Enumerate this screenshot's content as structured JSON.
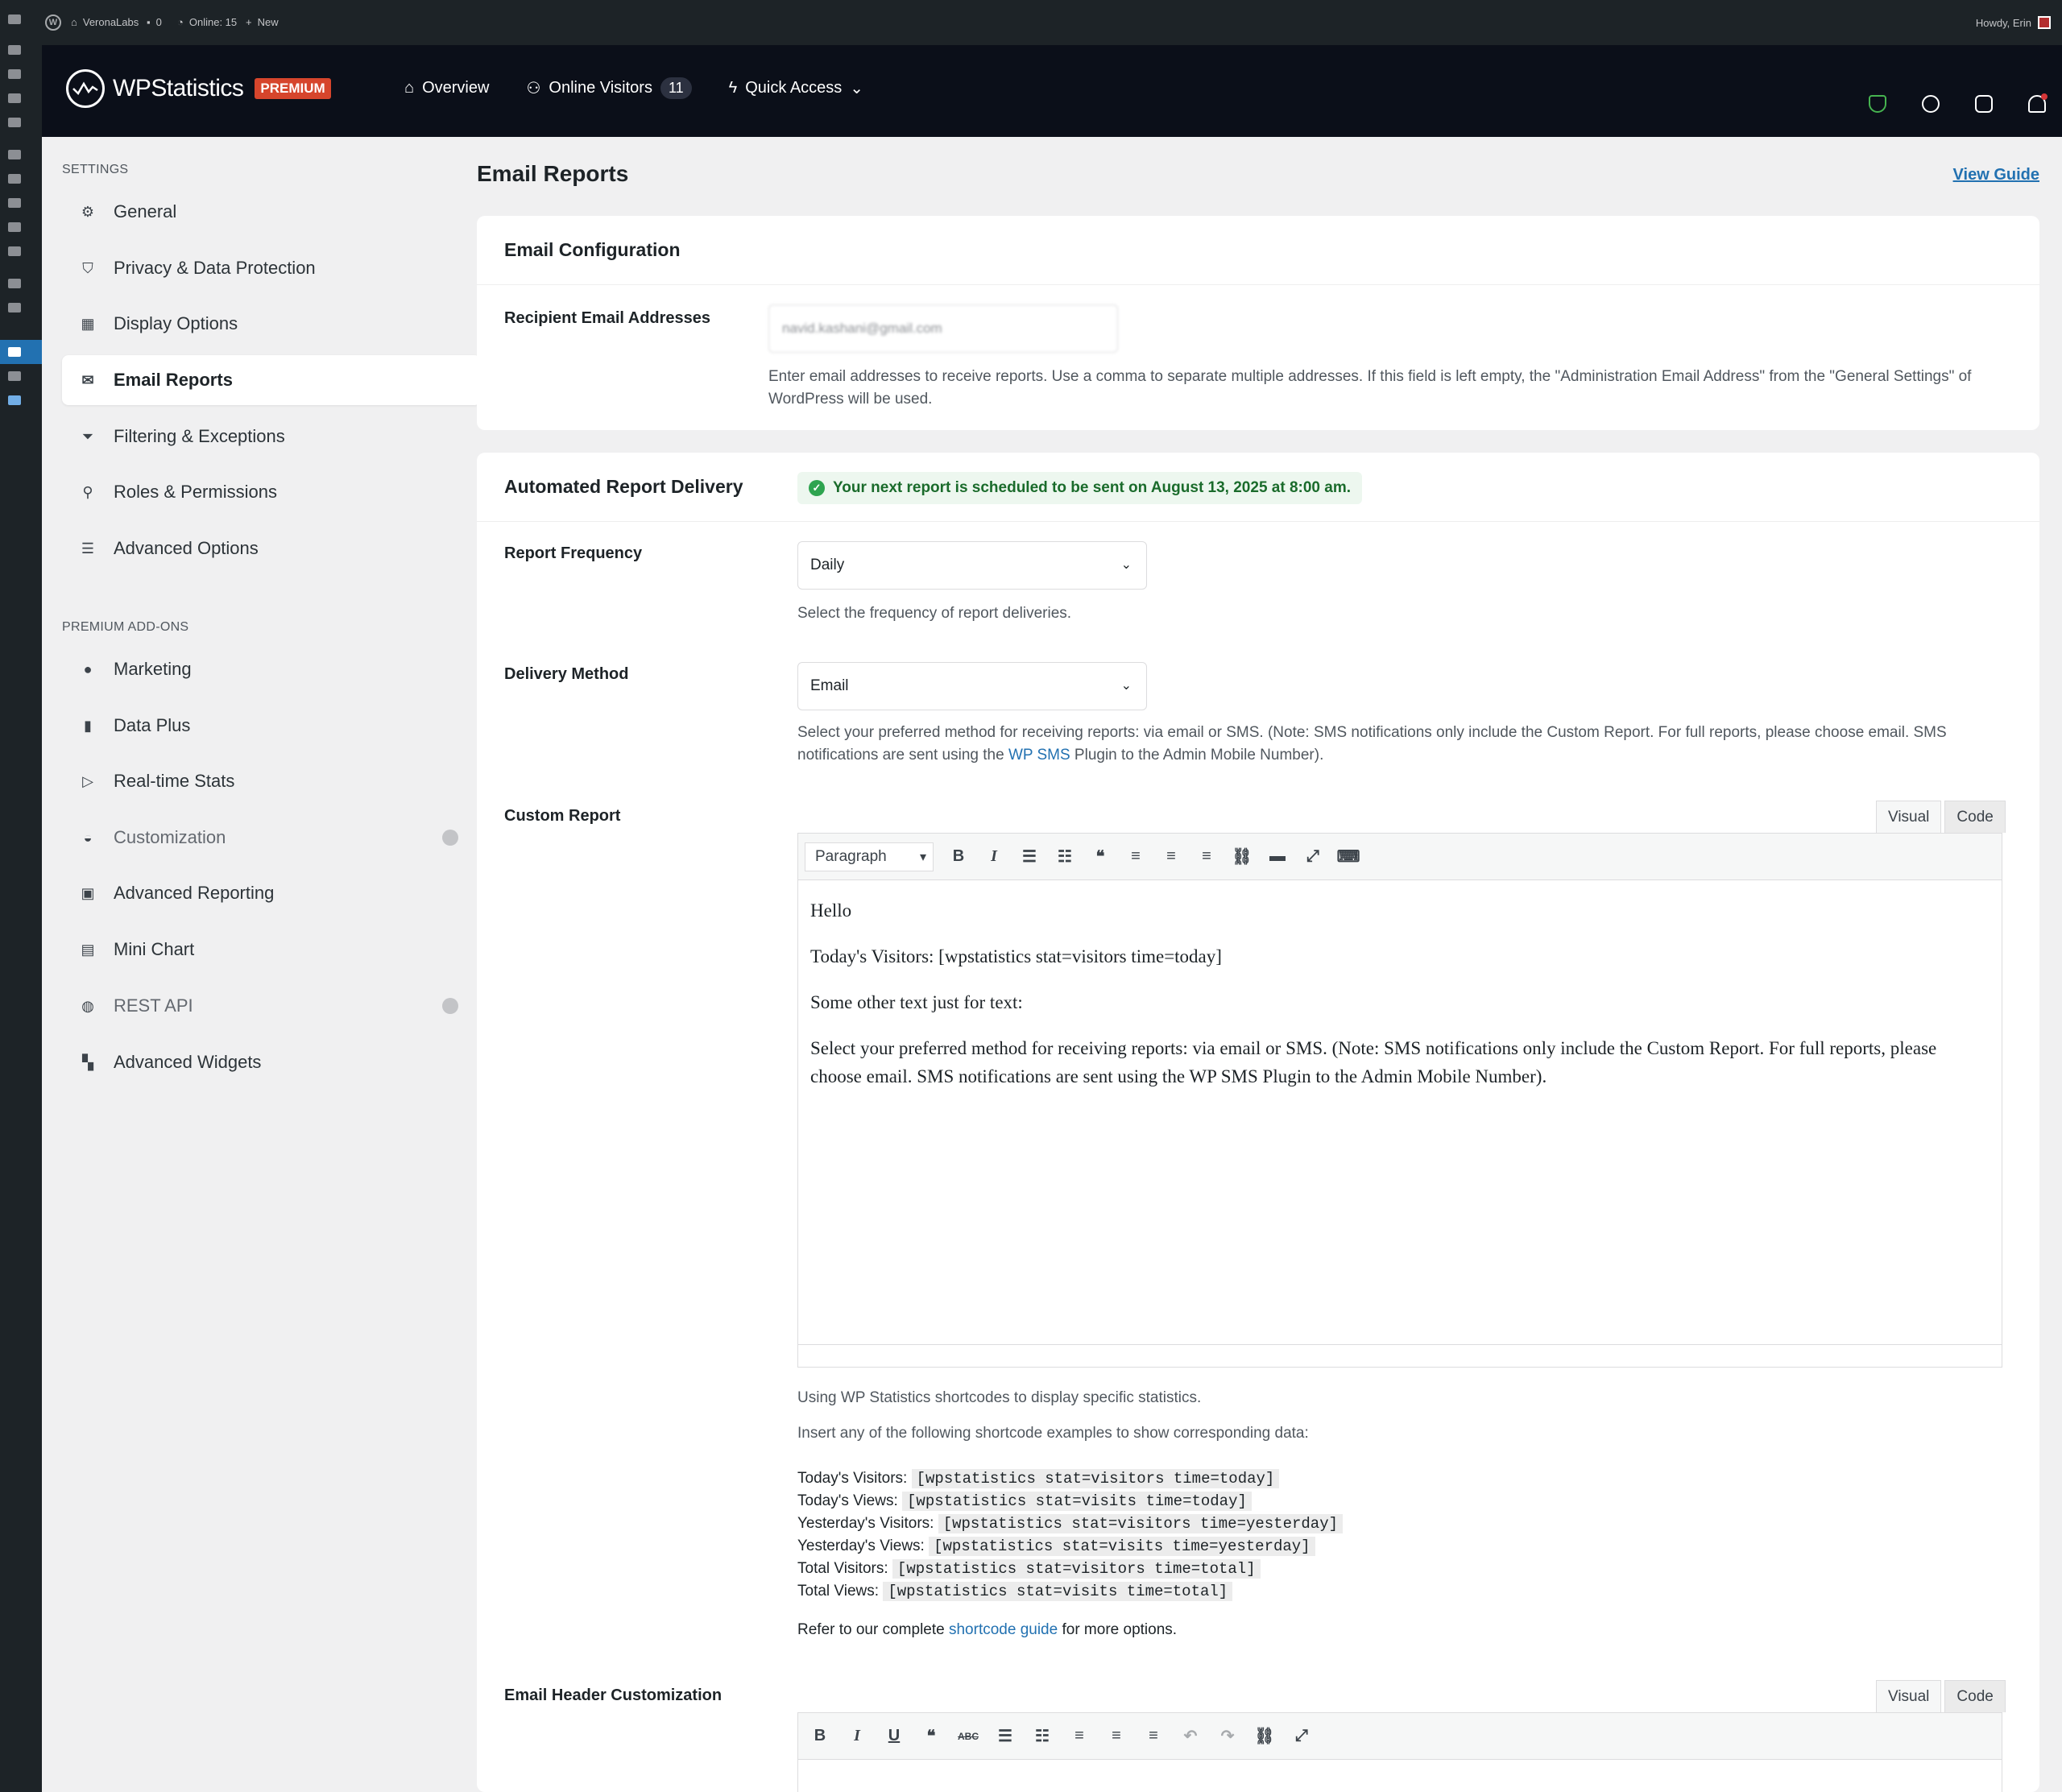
{
  "adminbar": {
    "site_name": "VeronaLabs",
    "comments": "0",
    "online": "Online: 15",
    "new_label": "New",
    "howdy": "Howdy, Erin"
  },
  "brand": {
    "name": "WPStatistics",
    "badge": "PREMIUM"
  },
  "nav": {
    "overview": "Overview",
    "online_visitors": "Online Visitors",
    "online_count": "11",
    "quick_access": "Quick Access"
  },
  "sidebar": {
    "settings_title": "SETTINGS",
    "settings_items": [
      {
        "label": "General"
      },
      {
        "label": "Privacy & Data Protection"
      },
      {
        "label": "Display Options"
      },
      {
        "label": "Email Reports"
      },
      {
        "label": "Filtering & Exceptions"
      },
      {
        "label": "Roles & Permissions"
      },
      {
        "label": "Advanced Options"
      }
    ],
    "addons_title": "PREMIUM ADD-ONS",
    "addon_items": [
      {
        "label": "Marketing"
      },
      {
        "label": "Data Plus"
      },
      {
        "label": "Real-time Stats"
      },
      {
        "label": "Customization"
      },
      {
        "label": "Advanced Reporting"
      },
      {
        "label": "Mini Chart"
      },
      {
        "label": "REST API"
      },
      {
        "label": "Advanced Widgets"
      }
    ]
  },
  "page": {
    "title": "Email Reports",
    "view_guide": "View Guide"
  },
  "email_config": {
    "title": "Email Configuration",
    "recipient_label": "Recipient Email Addresses",
    "recipient_value": "navid.kashani@gmail.com",
    "recipient_help": "Enter email addresses to receive reports. Use a comma to separate multiple addresses. If this field is left empty, the \"Administration Email Address\" from the \"General Settings\" of WordPress will be used."
  },
  "delivery": {
    "title": "Automated Report Delivery",
    "notice": "Your next report is scheduled to be sent on August 13, 2025 at 8:00 am.",
    "frequency_label": "Report Frequency",
    "frequency_value": "Daily",
    "frequency_help": "Select the frequency of report deliveries.",
    "method_label": "Delivery Method",
    "method_value": "Email",
    "method_help_before": "Select your preferred method for receiving reports: via email or SMS. (Note: SMS notifications only include the Custom Report. For full reports, please choose email. SMS notifications are sent using the ",
    "method_help_link": "WP SMS",
    "method_help_after": " Plugin to the Admin Mobile Number).",
    "custom_label": "Custom Report",
    "tab_visual": "Visual",
    "tab_code": "Code",
    "format_select": "Paragraph",
    "editor_lines": [
      "Hello",
      "Today's Visitors: [wpstatistics stat=visitors time=today]",
      "Some other text just for text:",
      "Select your preferred method for receiving reports: via email or SMS. (Note: SMS notifications only include the Custom Report. For full reports, please choose email. SMS notifications are sent using the WP SMS Plugin to the Admin Mobile Number)."
    ],
    "shortcode_intro": "Using WP Statistics shortcodes to display specific statistics.",
    "shortcode_insert": "Insert any of the following shortcode examples to show corresponding data:",
    "shortcodes": [
      {
        "label": "Today's Visitors:",
        "code": "[wpstatistics stat=visitors time=today]"
      },
      {
        "label": "Today's Views:",
        "code": "[wpstatistics stat=visits time=today]"
      },
      {
        "label": "Yesterday's Visitors:",
        "code": "[wpstatistics stat=visitors time=yesterday]"
      },
      {
        "label": "Yesterday's Views:",
        "code": "[wpstatistics stat=visits time=yesterday]"
      },
      {
        "label": "Total Visitors:",
        "code": "[wpstatistics stat=visitors time=total]"
      },
      {
        "label": "Total Views:",
        "code": "[wpstatistics stat=visits time=total]"
      }
    ],
    "refer_before": "Refer to our complete ",
    "refer_link": "shortcode guide",
    "refer_after": " for more options.",
    "header_label": "Email Header Customization"
  }
}
